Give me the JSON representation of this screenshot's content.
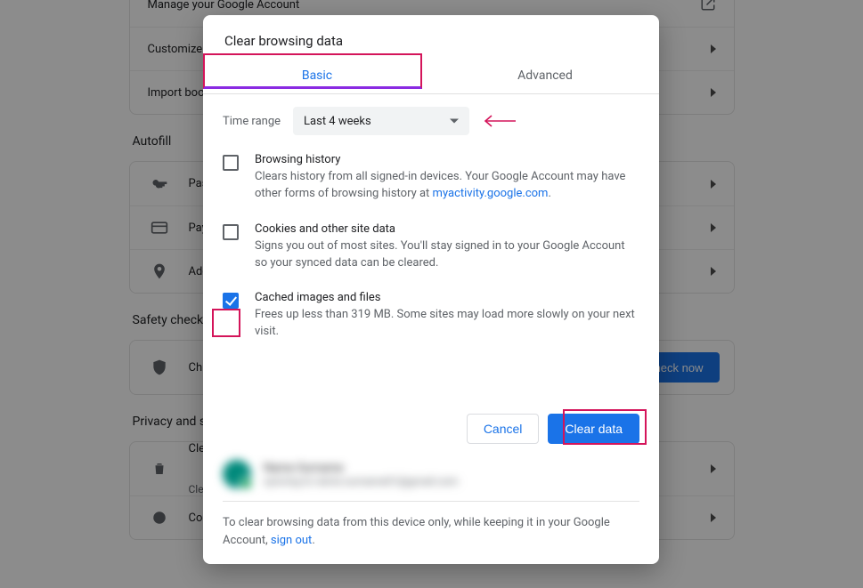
{
  "bg": {
    "rows_top": [
      {
        "label": "Manage your Google Account",
        "trailing": "ext"
      },
      {
        "label": "Customize your Chrome profile",
        "trailing": "chev"
      },
      {
        "label": "Import bookmarks and settings",
        "trailing": "chev"
      }
    ],
    "section_autofill": "Autofill",
    "rows_autofill": [
      {
        "icon": "key",
        "label": "Passwords"
      },
      {
        "icon": "card",
        "label": "Payment methods"
      },
      {
        "icon": "pin",
        "label": "Addresses and more"
      }
    ],
    "section_safety": "Safety check",
    "safety_label": "Chrome can help keep you safe",
    "check_now": "Check now",
    "section_privacy": "Privacy and security",
    "rows_privacy": [
      {
        "icon": "trash",
        "label": "Clear browsing data",
        "sub": "Clear history, cookies, cache, and more"
      },
      {
        "icon": "cookie",
        "label": "Cookies and other site data"
      }
    ]
  },
  "dialog": {
    "title": "Clear browsing data",
    "tabs": {
      "basic": "Basic",
      "advanced": "Advanced"
    },
    "time_range_label": "Time range",
    "time_range_value": "Last 4 weeks",
    "options": [
      {
        "title": "Browsing history",
        "desc_a": "Clears history from all signed-in devices. Your Google Account may have other forms of browsing history at ",
        "link": "myactivity.google.com",
        "desc_b": ".",
        "checked": false
      },
      {
        "title": "Cookies and other site data",
        "desc_a": "Signs you out of most sites. You'll stay signed in to your Google Account so your synced data can be cleared.",
        "link": "",
        "desc_b": "",
        "checked": false
      },
      {
        "title": "Cached images and files",
        "desc_a": "Frees up less than 319 MB. Some sites may load more slowly on your next visit.",
        "link": "",
        "desc_b": "",
        "checked": true
      }
    ],
    "cancel": "Cancel",
    "clear": "Clear data",
    "account": {
      "name": "Name Surname",
      "email": "syncing to name.surname01@gmail.com"
    },
    "footer_a": "To clear browsing data from this device only, while keeping it in your Google Account, ",
    "footer_link": "sign out",
    "footer_b": "."
  }
}
